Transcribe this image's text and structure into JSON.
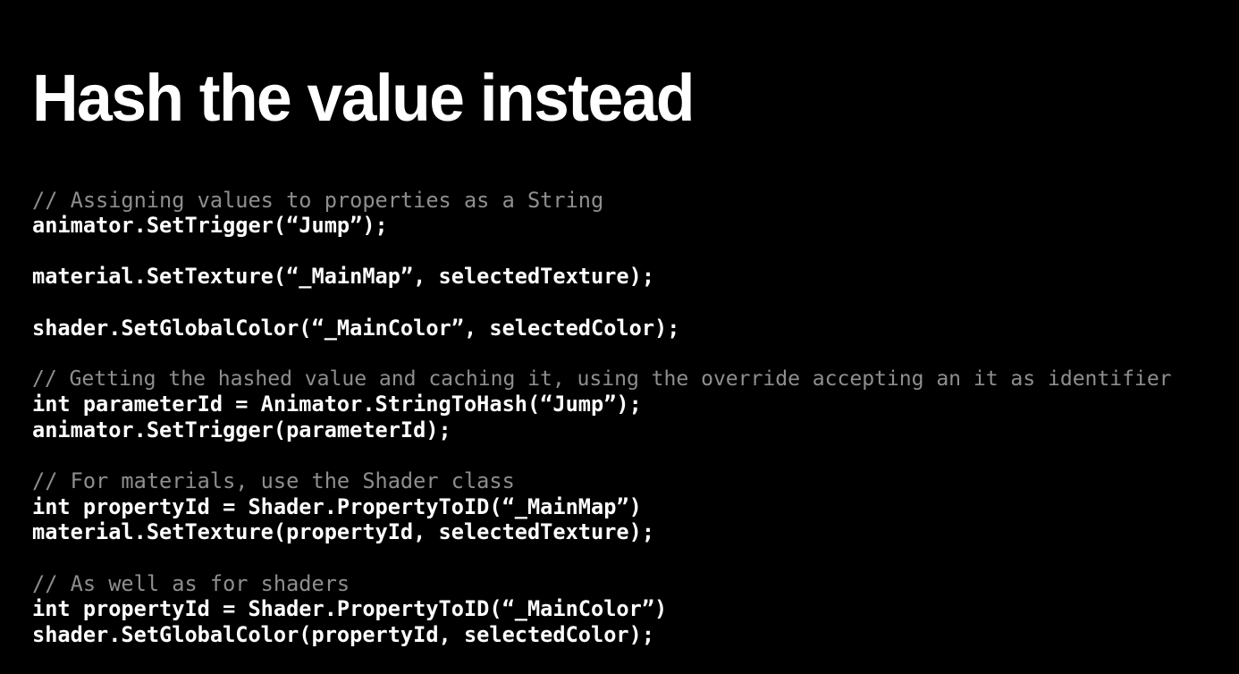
{
  "slide": {
    "title": "Hash the value instead",
    "background_color": "#000000",
    "title_color": "#ffffff",
    "comment_color": "#8e8e8e",
    "code_color": "#ffffff"
  },
  "code": {
    "lines": [
      {
        "kind": "comment",
        "text": "// Assigning values to properties as a String"
      },
      {
        "kind": "code",
        "text": "animator.SetTrigger(“Jump”);"
      },
      {
        "kind": "blank",
        "text": " "
      },
      {
        "kind": "code",
        "text": "material.SetTexture(“_MainMap”, selectedTexture);"
      },
      {
        "kind": "blank",
        "text": " "
      },
      {
        "kind": "code",
        "text": "shader.SetGlobalColor(“_MainColor”, selectedColor);"
      },
      {
        "kind": "blank",
        "text": " "
      },
      {
        "kind": "comment",
        "text": "// Getting the hashed value and caching it, using the override accepting an it as identifier",
        "wide": true
      },
      {
        "kind": "code",
        "text": "int parameterId = Animator.StringToHash(“Jump”);"
      },
      {
        "kind": "code",
        "text": "animator.SetTrigger(parameterId);"
      },
      {
        "kind": "blank",
        "text": " "
      },
      {
        "kind": "comment",
        "text": "// For materials, use the Shader class"
      },
      {
        "kind": "code",
        "text": "int propertyId = Shader.PropertyToID(“_MainMap”)"
      },
      {
        "kind": "code",
        "text": "material.SetTexture(propertyId, selectedTexture);"
      },
      {
        "kind": "blank",
        "text": " "
      },
      {
        "kind": "comment",
        "text": "// As well as for shaders"
      },
      {
        "kind": "code",
        "text": "int propertyId = Shader.PropertyToID(“_MainColor”)"
      },
      {
        "kind": "code",
        "text": "shader.SetGlobalColor(propertyId, selectedColor);"
      }
    ]
  }
}
